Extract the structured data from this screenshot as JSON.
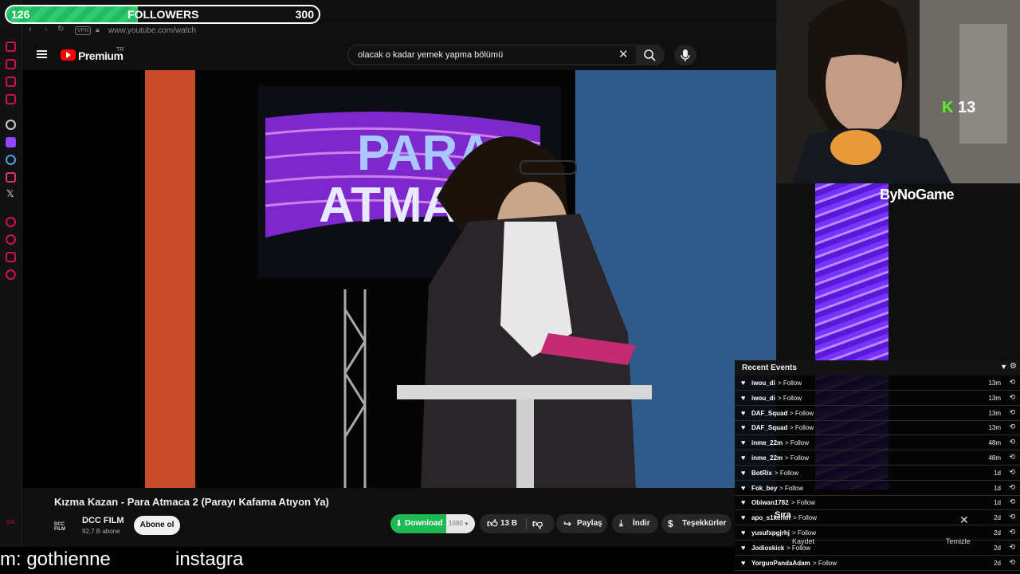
{
  "follower_goal": {
    "current": "126",
    "label": "FOLLOWERS",
    "target": "300",
    "progress": 0.42
  },
  "browser": {
    "vpn": "VPN",
    "url": "www.youtube.com/watch"
  },
  "youtube": {
    "premium_label": "Premium",
    "region": "TR",
    "search_value": "olacak o kadar yemek yapma bölümü",
    "video_title": "Kızma Kazan - Para Atmaca 2 (Parayı Kafama Atıyon Ya)",
    "channel_logo_text": "DCC FILM",
    "channel_name": "DCC FILM",
    "subscribers": "92,7 B abone",
    "subscribe_label": "Abone ol",
    "download_label": "Download",
    "quality": "1080",
    "like_count": "13 B",
    "share_label": "Paylaş",
    "download_tr_label": "İndir",
    "thanks_label": "Teşekkürler",
    "save_label": "Kaydet",
    "clear_label": "Temizle",
    "overlay_partial": "Sıra"
  },
  "video_scene": {
    "sign_line1": "PARA",
    "sign_line2": "ATMACA"
  },
  "kick": {
    "logo": "K",
    "viewers": "13"
  },
  "sponsor": "ByNoGame",
  "recent_events": {
    "title": "Recent Events",
    "items": [
      {
        "user": "iwou_di",
        "action": "> Follow",
        "ago": "13m"
      },
      {
        "user": "iwou_di",
        "action": "> Follow",
        "ago": "13m"
      },
      {
        "user": "DAF_Squad",
        "action": "> Follow",
        "ago": "13m"
      },
      {
        "user": "DAF_Squad",
        "action": "> Follow",
        "ago": "13m"
      },
      {
        "user": "inme_22m",
        "action": "> Follow",
        "ago": "48m"
      },
      {
        "user": "inme_22m",
        "action": "> Follow",
        "ago": "48m"
      },
      {
        "user": "BotRix",
        "action": "> Follow",
        "ago": "1d"
      },
      {
        "user": "Fok_bey",
        "action": "> Follow",
        "ago": "1d"
      },
      {
        "user": "Obiwan1782",
        "action": "> Follow",
        "ago": "1d"
      },
      {
        "user": "apo_s1kerim",
        "action": "> Follow",
        "ago": "2d"
      },
      {
        "user": "yusufxpgjrhj",
        "action": "> Follow",
        "ago": "2d"
      },
      {
        "user": "Jodioskick",
        "action": "> Follow",
        "ago": "2d"
      },
      {
        "user": "YorgunPandaAdam",
        "action": "> Follow",
        "ago": "2d"
      }
    ]
  },
  "ticker": {
    "left": "m: gothienne",
    "right": "instagra"
  },
  "colors": {
    "accent_red": "#ff0000",
    "follow_green": "#2ecc71",
    "kick_green": "#53fc18",
    "download_green": "#1db954",
    "rail_pink": "#d0104a"
  }
}
